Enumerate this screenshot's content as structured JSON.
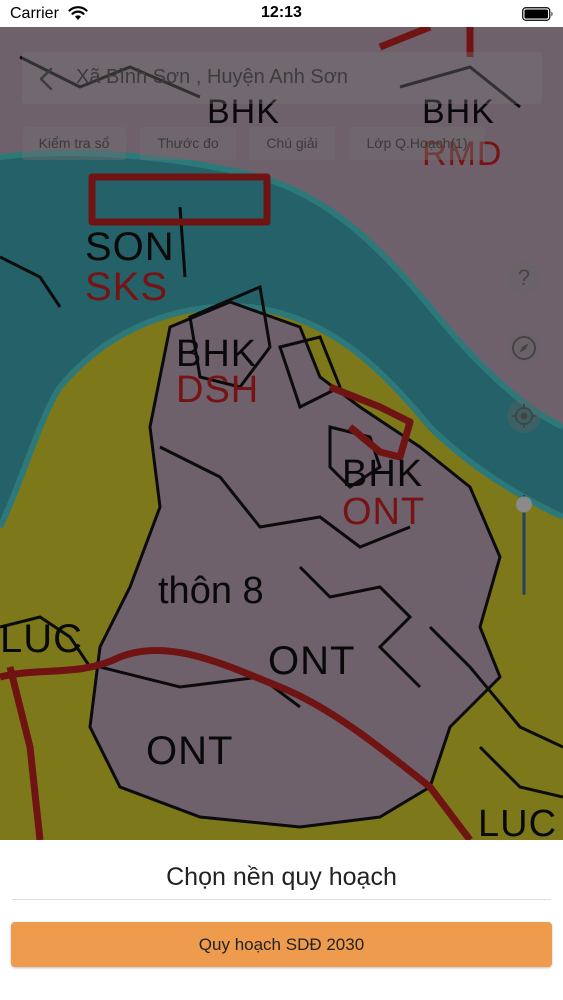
{
  "status_bar": {
    "carrier": "Carrier",
    "time": "12:13"
  },
  "header": {
    "back_icon": "chevron-left-icon",
    "title": "Xã Bình Sơn , Huyện Anh Sơn"
  },
  "toolbar": {
    "items": [
      {
        "label": "Kiểm tra sổ"
      },
      {
        "label": "Thước đo"
      },
      {
        "label": "Chú giải"
      },
      {
        "label": "Lớp Q.Hoạch(1)"
      }
    ]
  },
  "map_controls": {
    "help_label": "?",
    "icons": [
      "question-icon",
      "compass-icon",
      "locate-icon"
    ],
    "zoom_level": 0.1
  },
  "map": {
    "labels": [
      "BHK",
      "BHK",
      "RMD",
      "SON",
      "SKS",
      "BHK",
      "DSH",
      "BHK",
      "ONT",
      "thôn 8",
      "LUC",
      "ONT",
      "ONT",
      "LUC"
    ],
    "colors": {
      "residential": "#bfa7ba",
      "river": "#3fa7b3",
      "river_bank": "#4fd0d3",
      "agricultural": "#d8cf2d",
      "boundary": "#c22222"
    }
  },
  "bottom_sheet": {
    "title": "Chọn nền quy hoạch",
    "option_label": "Quy hoạch SDĐ 2030",
    "accent_color": "#ef9b4d"
  }
}
